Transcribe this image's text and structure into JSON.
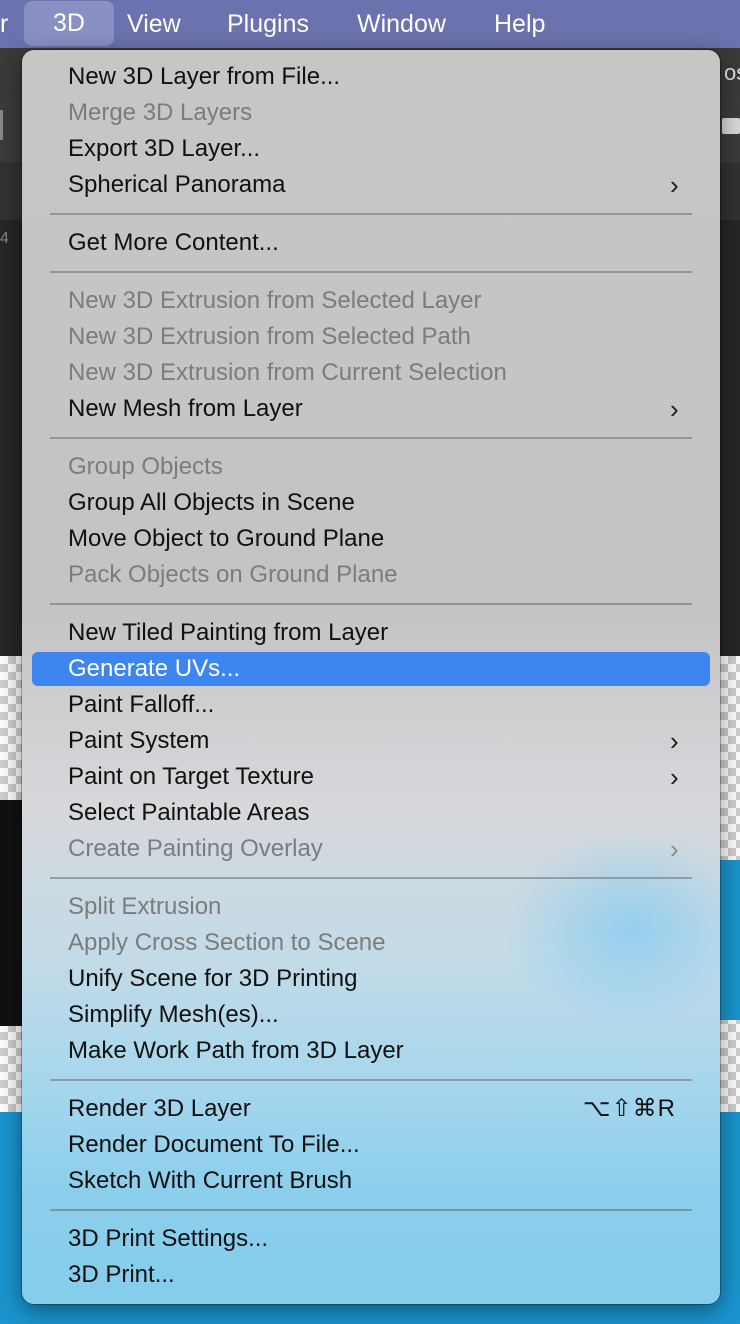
{
  "menubar": {
    "items": [
      "r",
      "3D",
      "View",
      "Plugins",
      "Window",
      "Help"
    ],
    "active_index": 1
  },
  "background": {
    "side_text": "os",
    "left_mark": "4"
  },
  "menu": {
    "highlight_color": "#3d86ef",
    "submenu_arrow": "›",
    "items": [
      {
        "label": "New 3D Layer from File...",
        "enabled": true
      },
      {
        "label": "Merge 3D Layers",
        "enabled": false
      },
      {
        "label": "Export 3D Layer...",
        "enabled": true
      },
      {
        "label": "Spherical Panorama",
        "enabled": true,
        "submenu": true
      },
      {
        "label": "Get More Content...",
        "enabled": true
      },
      {
        "label": "New 3D Extrusion from Selected Layer",
        "enabled": false
      },
      {
        "label": "New 3D Extrusion from Selected Path",
        "enabled": false
      },
      {
        "label": "New 3D Extrusion from Current Selection",
        "enabled": false
      },
      {
        "label": "New Mesh from Layer",
        "enabled": true,
        "submenu": true
      },
      {
        "label": "Group Objects",
        "enabled": false
      },
      {
        "label": "Group All Objects in Scene",
        "enabled": true
      },
      {
        "label": "Move Object to Ground Plane",
        "enabled": true
      },
      {
        "label": "Pack Objects on Ground Plane",
        "enabled": false
      },
      {
        "label": "New Tiled Painting from Layer",
        "enabled": true
      },
      {
        "label": "Generate UVs...",
        "enabled": true,
        "highlighted": true
      },
      {
        "label": "Paint Falloff...",
        "enabled": true
      },
      {
        "label": "Paint System",
        "enabled": true,
        "submenu": true
      },
      {
        "label": "Paint on Target Texture",
        "enabled": true,
        "submenu": true
      },
      {
        "label": "Select Paintable Areas",
        "enabled": true
      },
      {
        "label": "Create Painting Overlay",
        "enabled": false,
        "submenu": true
      },
      {
        "label": "Split Extrusion",
        "enabled": false
      },
      {
        "label": "Apply Cross Section to Scene",
        "enabled": false
      },
      {
        "label": "Unify Scene for 3D Printing",
        "enabled": true
      },
      {
        "label": "Simplify Mesh(es)...",
        "enabled": true
      },
      {
        "label": "Make Work Path from 3D Layer",
        "enabled": true
      },
      {
        "label": "Render 3D Layer",
        "enabled": true,
        "shortcut": "⌥⇧⌘R"
      },
      {
        "label": "Render Document To File...",
        "enabled": true
      },
      {
        "label": "Sketch With Current Brush",
        "enabled": true
      },
      {
        "label": "3D Print Settings...",
        "enabled": true
      },
      {
        "label": "3D Print...",
        "enabled": true
      }
    ]
  }
}
